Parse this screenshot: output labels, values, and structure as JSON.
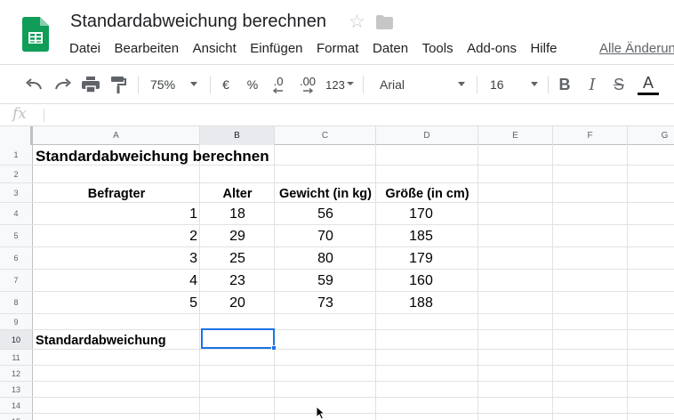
{
  "app": {
    "title": "Standardabweichung berechnen",
    "icons": {
      "logo": "google-sheets-logo",
      "star": "star-outline-icon",
      "folder": "folder-icon"
    },
    "accent_color": "#1a73e8",
    "logo_color": "#0f9d58"
  },
  "menu": {
    "items": [
      "Datei",
      "Bearbeiten",
      "Ansicht",
      "Einfügen",
      "Format",
      "Daten",
      "Tools",
      "Add-ons",
      "Hilfe"
    ],
    "last_edit": "Alle Änderun"
  },
  "toolbar": {
    "zoom": "75%",
    "currency": "€",
    "percent": "%",
    "decrease_decimals": ".0",
    "increase_decimals": ".00",
    "more_formats": "123",
    "font": "Arial",
    "font_size": "16",
    "bold": "B",
    "italic": "I",
    "strikethrough": "S",
    "text_color": "A",
    "icons": [
      "undo-icon",
      "redo-icon",
      "print-icon",
      "paint-format-icon",
      "chevron-down-icon"
    ]
  },
  "formula_bar": {
    "fx": "fx",
    "value": ""
  },
  "grid": {
    "columns": [
      "A",
      "B",
      "C",
      "D",
      "E",
      "F",
      "G"
    ],
    "selected_column": "B",
    "rows": [
      "1",
      "2",
      "3",
      "4",
      "5",
      "6",
      "7",
      "8",
      "9",
      "10",
      "11",
      "12",
      "13",
      "14",
      "15"
    ],
    "selected_row": "10",
    "selected_cell": "B10",
    "title": "Standardabweichung berechnen",
    "headers": [
      "Befragter",
      "Alter",
      "Gewicht (in kg)",
      "Größe (in cm)"
    ],
    "data": [
      [
        "1",
        "18",
        "56",
        "170"
      ],
      [
        "2",
        "29",
        "70",
        "185"
      ],
      [
        "3",
        "25",
        "80",
        "179"
      ],
      [
        "4",
        "23",
        "59",
        "160"
      ],
      [
        "5",
        "20",
        "73",
        "188"
      ]
    ],
    "footer_label": "Standardabweichung"
  }
}
